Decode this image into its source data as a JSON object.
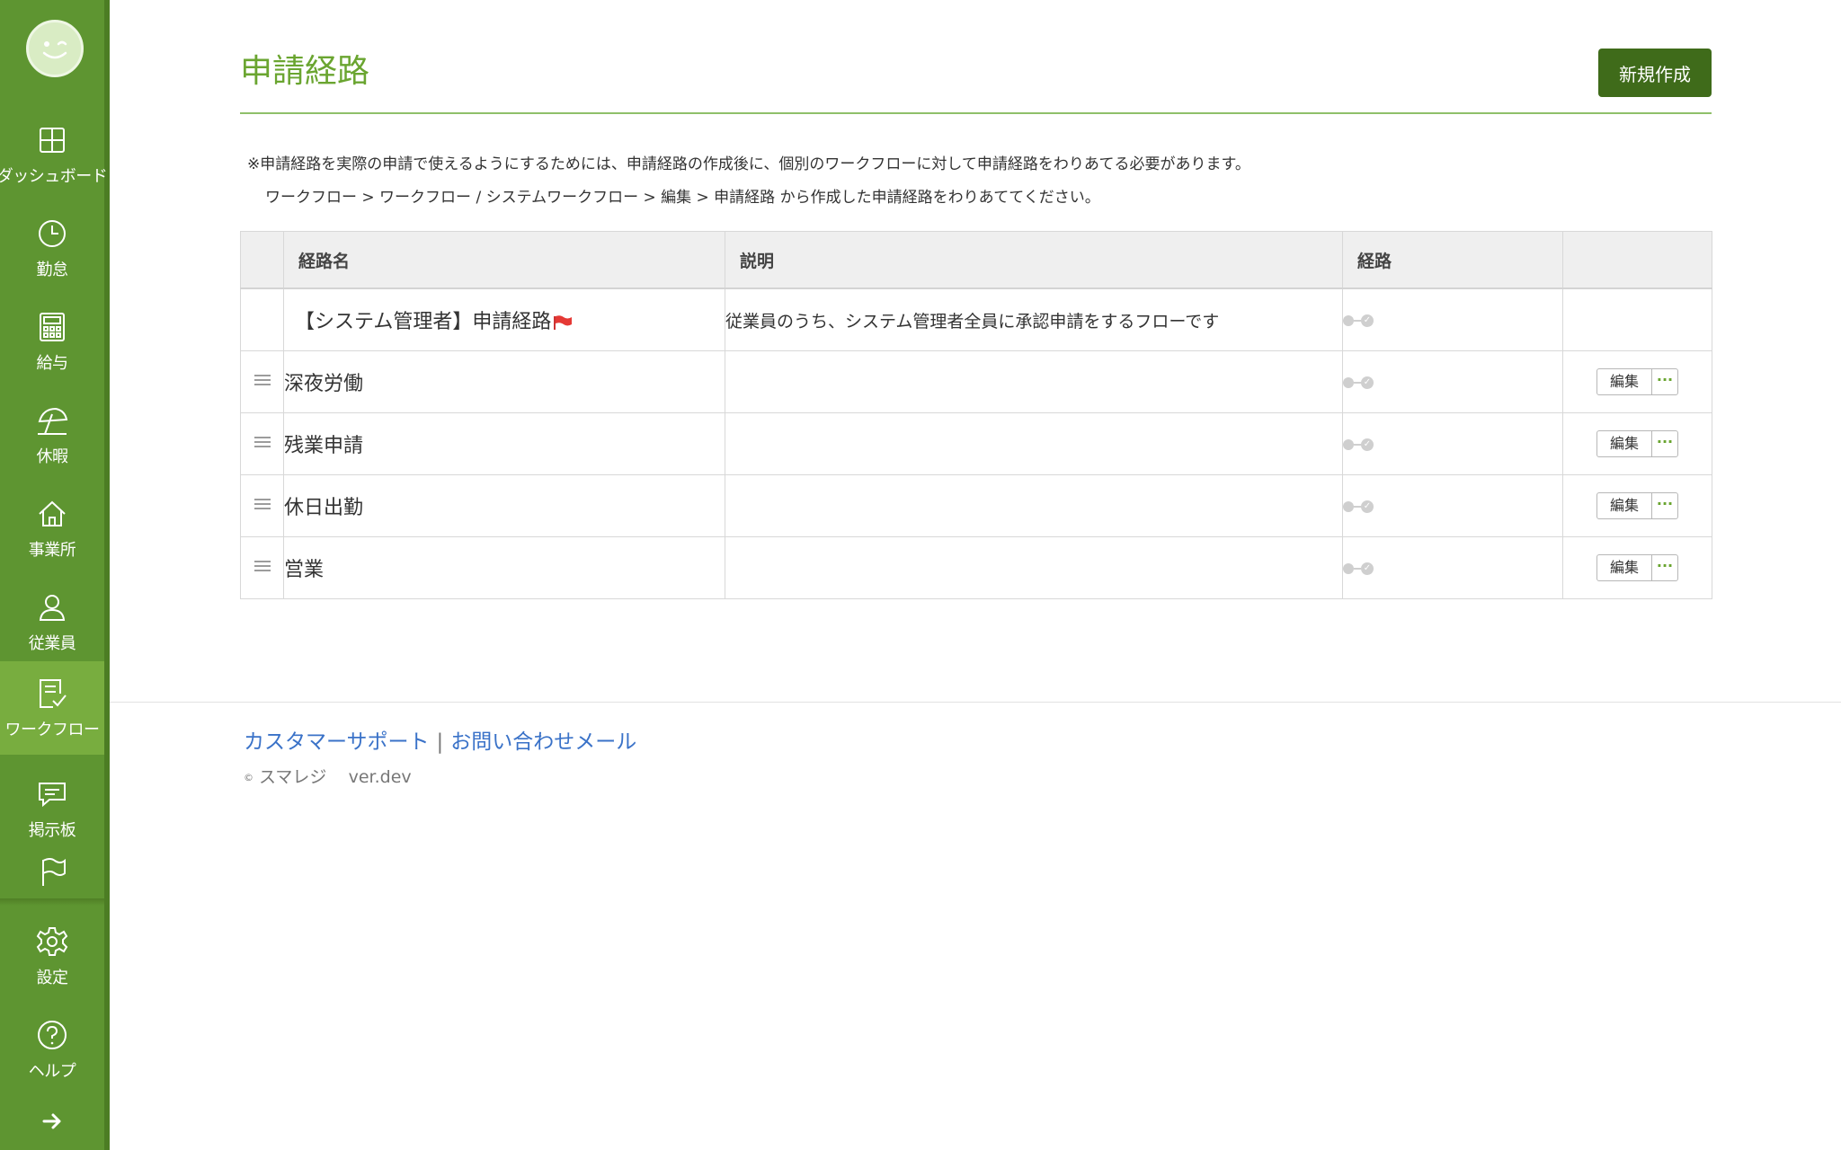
{
  "sidebar": {
    "items": [
      {
        "id": "dashboard",
        "label": "ダッシュボード",
        "icon": "dashboard-icon"
      },
      {
        "id": "attendance",
        "label": "勤怠",
        "icon": "clock-icon"
      },
      {
        "id": "payroll",
        "label": "給与",
        "icon": "calculator-icon"
      },
      {
        "id": "vacation",
        "label": "休暇",
        "icon": "beach-umbrella-icon"
      },
      {
        "id": "office",
        "label": "事業所",
        "icon": "home-icon"
      },
      {
        "id": "employees",
        "label": "従業員",
        "icon": "person-icon"
      },
      {
        "id": "workflow",
        "label": "ワークフロー",
        "icon": "checklist-icon"
      },
      {
        "id": "board",
        "label": "掲示板",
        "icon": "chat-icon"
      },
      {
        "id": "flag",
        "label": "",
        "icon": "flag-icon"
      }
    ],
    "bottom": [
      {
        "id": "settings",
        "label": "設定",
        "icon": "gear-icon"
      },
      {
        "id": "help",
        "label": "ヘルプ",
        "icon": "help-icon"
      }
    ],
    "toggle_icon": "arrow-right-icon"
  },
  "page": {
    "title": "申請経路",
    "new_button": "新規作成",
    "note_line1": "※申請経路を実際の申請で使えるようにするためには、申請経路の作成後に、個別のワークフローに対して申請経路をわりあてる必要があります。",
    "note_line2": "ワークフロー > ワークフロー / システムワークフロー > 編集 > 申請経路 から作成した申請経路をわりあててください。"
  },
  "table": {
    "headers": {
      "name": "経路名",
      "description": "説明",
      "route": "経路"
    },
    "rows": [
      {
        "name": "【システム管理者】申請経路",
        "description": "従業員のうち、システム管理者全員に承認申請をするフローです",
        "system": true
      },
      {
        "name": "深夜労働",
        "description": "",
        "system": false
      },
      {
        "name": "残業申請",
        "description": "",
        "system": false
      },
      {
        "name": "休日出勤",
        "description": "",
        "system": false
      },
      {
        "name": "営業",
        "description": "",
        "system": false
      }
    ],
    "edit_label": "編集",
    "more_label": "···"
  },
  "footer": {
    "support": "カスタマーサポート",
    "separator": "|",
    "contact": "お問い合わせメール",
    "copyright_symbol": "©",
    "company": "スマレジ",
    "version": "ver.dev"
  },
  "colors": {
    "sidebar": "#5e9531",
    "accent": "#6aa530",
    "button": "#3f6b1a",
    "link": "#3a72c8"
  }
}
